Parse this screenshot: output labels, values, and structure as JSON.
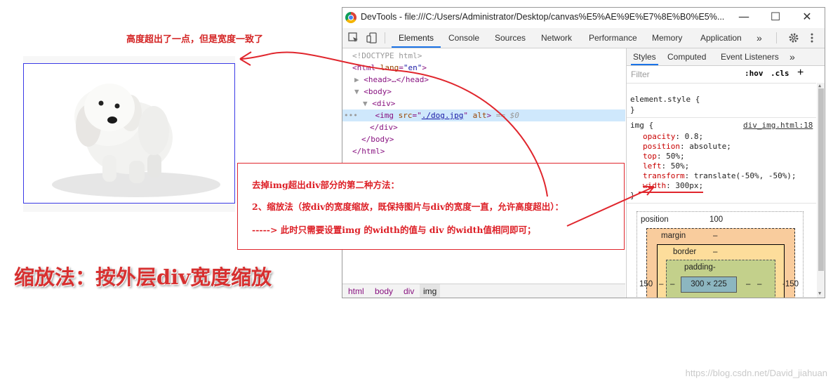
{
  "annotation_top": "高度超出了一点，但是宽度一致了",
  "heading": "缩放法：按外层div宽度缩放",
  "watermark": "https://blog.csdn.net/David_jiahuan",
  "note_box": {
    "line1": "去掉img超出div部分的第二种方法：",
    "line2": "2、缩放法（按div的宽度缩放，既保持图片与div的宽度一直，允许高度超出）：",
    "line3": "-----> 此时只需要设置img 的width的值与 div 的width值相同即可；"
  },
  "devtools": {
    "window_title": "DevTools - file:///C:/Users/Administrator/Desktop/canvas%E5%AE%9E%E7%8E%B0%E5%...",
    "controls": {
      "minimize": "—",
      "maximize": "☐",
      "close": "✕"
    },
    "tabs": [
      "Elements",
      "Console",
      "Sources",
      "Network",
      "Performance",
      "Memory",
      "Application"
    ],
    "more_tabs": "»",
    "tree": {
      "doctype": "<!DOCTYPE html>",
      "html_open_tag": "<html",
      "html_lang_attr": " lang",
      "html_lang_val": "\"en\"",
      "head": "<head>…</head>",
      "body_open": "<body>",
      "div_open": "<div>",
      "img_prefix": "<img ",
      "img_src_attr": "src",
      "img_src_val": "./dog.jpg",
      "img_alt": " alt",
      "img_suffix": " == $0",
      "dots": "•••",
      "div_close": "</div>",
      "body_close": "</body>",
      "html_close": "</html>"
    },
    "breadcrumbs": [
      "html",
      "body",
      "div",
      "img"
    ],
    "styles_tabs": [
      "Styles",
      "Computed",
      "Event Listeners"
    ],
    "styles_more": "»",
    "filter_placeholder": "Filter",
    "hov": ":hov",
    "cls": ".cls",
    "plus": "+",
    "element_style_open": "element.style {",
    "close_brace": "}",
    "rule": {
      "selector": "img {",
      "source": "div_img.html:18",
      "decls": [
        {
          "prop": "opacity",
          "value": "0.8;"
        },
        {
          "prop": "position",
          "value": "absolute;"
        },
        {
          "prop": "top",
          "value": "50%;"
        },
        {
          "prop": "left",
          "value": "50%;"
        },
        {
          "prop": "transform",
          "value": "translate(-50%, -50%);"
        },
        {
          "prop": "width",
          "value": "300px;"
        }
      ]
    },
    "box_model": {
      "position_label": "position",
      "position_top": "100",
      "position_left": "150",
      "position_right": "-150",
      "margin_label": "margin",
      "border_label": "border",
      "padding_label": "padding-",
      "dash": "–",
      "content": "300 × 225"
    }
  },
  "colors": {
    "annotation_red": "#dd1f26",
    "tab_accent": "#1a73e8",
    "selected_row": "#cfe8fc"
  }
}
